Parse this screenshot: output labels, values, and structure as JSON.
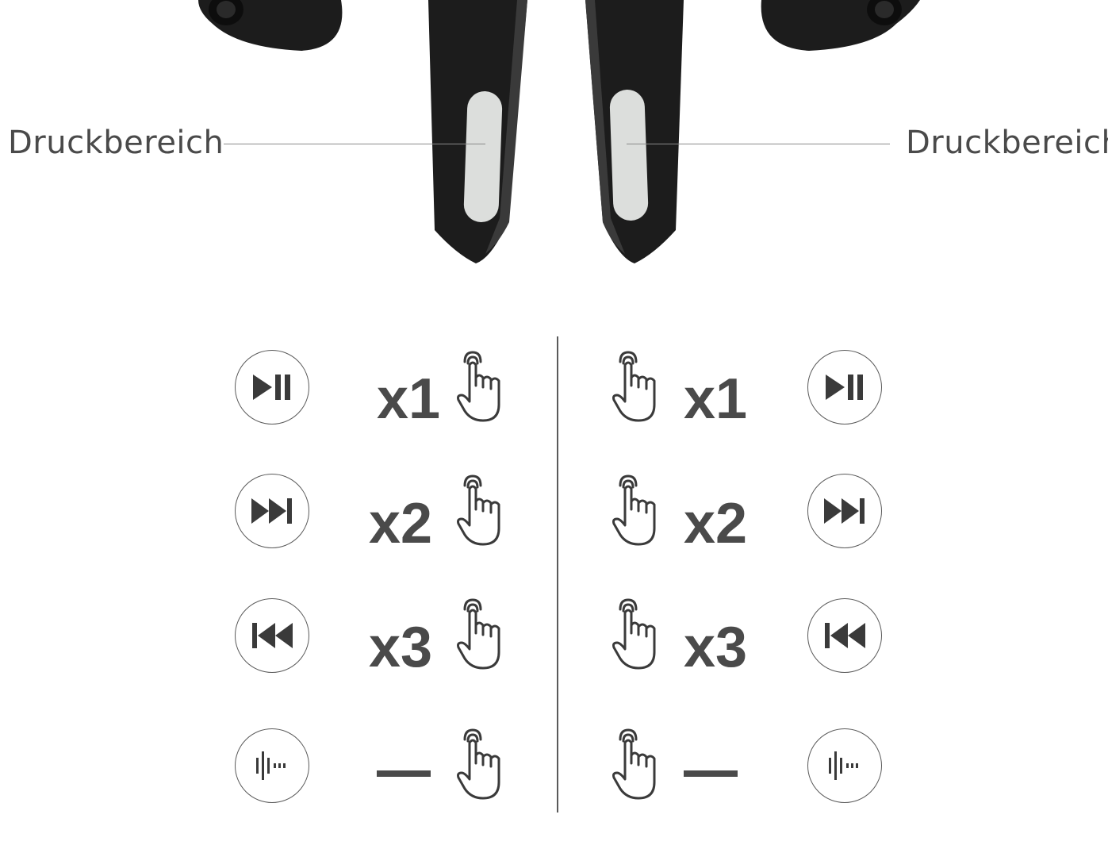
{
  "callouts": {
    "left_label": "Druckbereich",
    "right_label": "Druckbereich"
  },
  "left_controls": [
    {
      "action_icon": "play-pause-icon",
      "count": "x1"
    },
    {
      "action_icon": "next-track-icon",
      "count": "x2"
    },
    {
      "action_icon": "previous-track-icon",
      "count": "x3"
    },
    {
      "action_icon": "voice-assistant-icon",
      "count": "—"
    }
  ],
  "right_controls": [
    {
      "action_icon": "play-pause-icon",
      "count": "x1"
    },
    {
      "action_icon": "next-track-icon",
      "count": "x2"
    },
    {
      "action_icon": "previous-track-icon",
      "count": "x3"
    },
    {
      "action_icon": "voice-assistant-icon",
      "count": "—"
    }
  ],
  "colors": {
    "earbud": "#1a1a1a",
    "press_area": "#dcdedc",
    "text": "#4a4a4a"
  }
}
